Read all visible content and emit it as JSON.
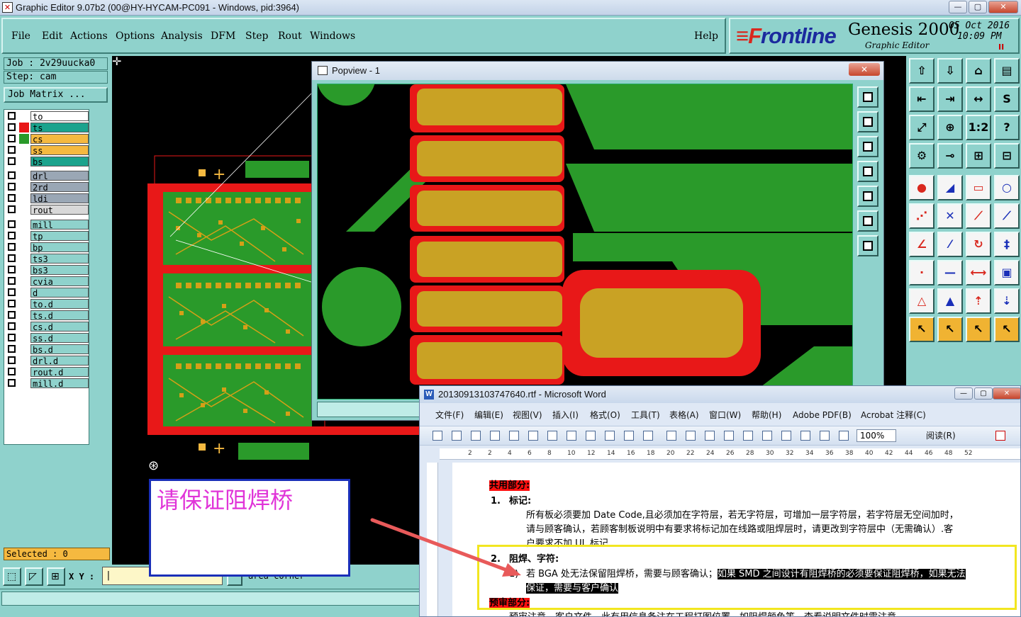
{
  "window": {
    "title": "Graphic Editor 9.07b2 (00@HY-HYCAM-PC091 - Windows, pid:3964)",
    "controls": [
      "—",
      "▢",
      "✕"
    ]
  },
  "menu": [
    "File",
    "Edit",
    "Actions",
    "Options",
    "Analysis",
    "DFM",
    "Step",
    "Rout",
    "Windows"
  ],
  "help_label": "Help",
  "brand": {
    "logo_f": "≡F",
    "logo_rest": "rontline",
    "product": "Genesis 2000",
    "subtitle": "Graphic Editor",
    "date": "05 Oct 2016",
    "time": "10:09 PM",
    "pause": "II"
  },
  "job": {
    "job_line": "Job : 2v29uucka0",
    "step_line": "Step: cam",
    "matrix_label": "Job Matrix ..."
  },
  "layers": [
    {
      "name": "to",
      "color": "#ffffff",
      "swatch": "#ffffff"
    },
    {
      "name": "ts",
      "color": "#1ba38d",
      "swatch": "#e81818"
    },
    {
      "name": "cs",
      "color": "#f5b940",
      "swatch": "#2a9a2a"
    },
    {
      "name": "ss",
      "color": "#f5b940",
      "swatch": "#ffffff"
    },
    {
      "name": "bs",
      "color": "#1ba38d",
      "swatch": "#ffffff"
    },
    {
      "name": "drl",
      "color": "#9aa7b5",
      "swatch": "#ffffff"
    },
    {
      "name": "2rd",
      "color": "#9aa7b5",
      "swatch": "#ffffff"
    },
    {
      "name": "ldi",
      "color": "#9aa7b5",
      "swatch": "#ffffff"
    },
    {
      "name": "rout",
      "color": "#d8d8d8",
      "swatch": "#ffffff"
    },
    {
      "name": "mill",
      "color": "#8fd2cc",
      "swatch": "#ffffff"
    },
    {
      "name": "tp",
      "color": "#8fd2cc",
      "swatch": "#ffffff"
    },
    {
      "name": "bp",
      "color": "#8fd2cc",
      "swatch": "#ffffff"
    },
    {
      "name": "ts3",
      "color": "#8fd2cc",
      "swatch": "#ffffff"
    },
    {
      "name": "bs3",
      "color": "#8fd2cc",
      "swatch": "#ffffff"
    },
    {
      "name": "cvia",
      "color": "#8fd2cc",
      "swatch": "#ffffff"
    },
    {
      "name": "d",
      "color": "#8fd2cc",
      "swatch": "#ffffff"
    },
    {
      "name": "to.d",
      "color": "#8fd2cc",
      "swatch": "#ffffff"
    },
    {
      "name": "ts.d",
      "color": "#8fd2cc",
      "swatch": "#ffffff"
    },
    {
      "name": "cs.d",
      "color": "#8fd2cc",
      "swatch": "#ffffff"
    },
    {
      "name": "ss.d",
      "color": "#8fd2cc",
      "swatch": "#ffffff"
    },
    {
      "name": "bs.d",
      "color": "#8fd2cc",
      "swatch": "#ffffff"
    },
    {
      "name": "drl.d",
      "color": "#8fd2cc",
      "swatch": "#ffffff"
    },
    {
      "name": "rout.d",
      "color": "#8fd2cc",
      "swatch": "#ffffff"
    },
    {
      "name": "mill.d",
      "color": "#8fd2cc",
      "swatch": "#ffffff"
    }
  ],
  "selected_label": "Selected : 0",
  "xy_label": "X Y :",
  "xy_value": "|",
  "prompt_text": "area corner",
  "note_text": "请保证阻焊桥",
  "popview": {
    "title": "Popview - 1",
    "close": "✕"
  },
  "word": {
    "title": "20130913103747640.rtf - Microsoft Word",
    "menu": [
      "文件(F)",
      "编辑(E)",
      "视图(V)",
      "插入(I)",
      "格式(O)",
      "工具(T)",
      "表格(A)",
      "窗口(W)",
      "帮助(H)",
      "Adobe PDF(B)",
      "Acrobat 注释(C)"
    ],
    "zoom": "100%",
    "read_label": "阅读(R)",
    "ruler_numbers": [
      "2",
      "2",
      "4",
      "6",
      "8",
      "10",
      "12",
      "14",
      "16",
      "18",
      "20",
      "22",
      "24",
      "26",
      "28",
      "30",
      "32",
      "34",
      "36",
      "38",
      "40",
      "42",
      "44",
      "46",
      "48",
      "52"
    ],
    "sec1_heading": "共用部分:",
    "item1_num": "1.",
    "item1_title": "标记:",
    "para1_a": "所有板必须要加 Date Code,且必须加在字符层，若无字符层，可增加一层字符层，若字符层无空间加时，",
    "para1_b": "请与顾客确认，若顾客制板说明中有要求将标记加在线路或阻焊层时，请更改到字符层中（无需确认）.客",
    "para1_c": "户要求不加 UL 标记",
    "item2_num": "2.",
    "item2_title": "阻焊、字符:",
    "sub1_num": "1)",
    "sub1_text": "若 BGA 处无法保留阻焊桥，需要与顾客确认；",
    "sub1_highlight": "如果 SMD 之间设计有阻焊桥的必须要保证阻焊桥，如果无法",
    "sub1_highlight2": "保证，需要与客户确认",
    "sec2_heading": "预审部分:",
    "sec2_text": "预审注意，客户文件，此有用信息备注在工程打图位置，如阻焊颜色等，查看说明文件时需注意"
  }
}
